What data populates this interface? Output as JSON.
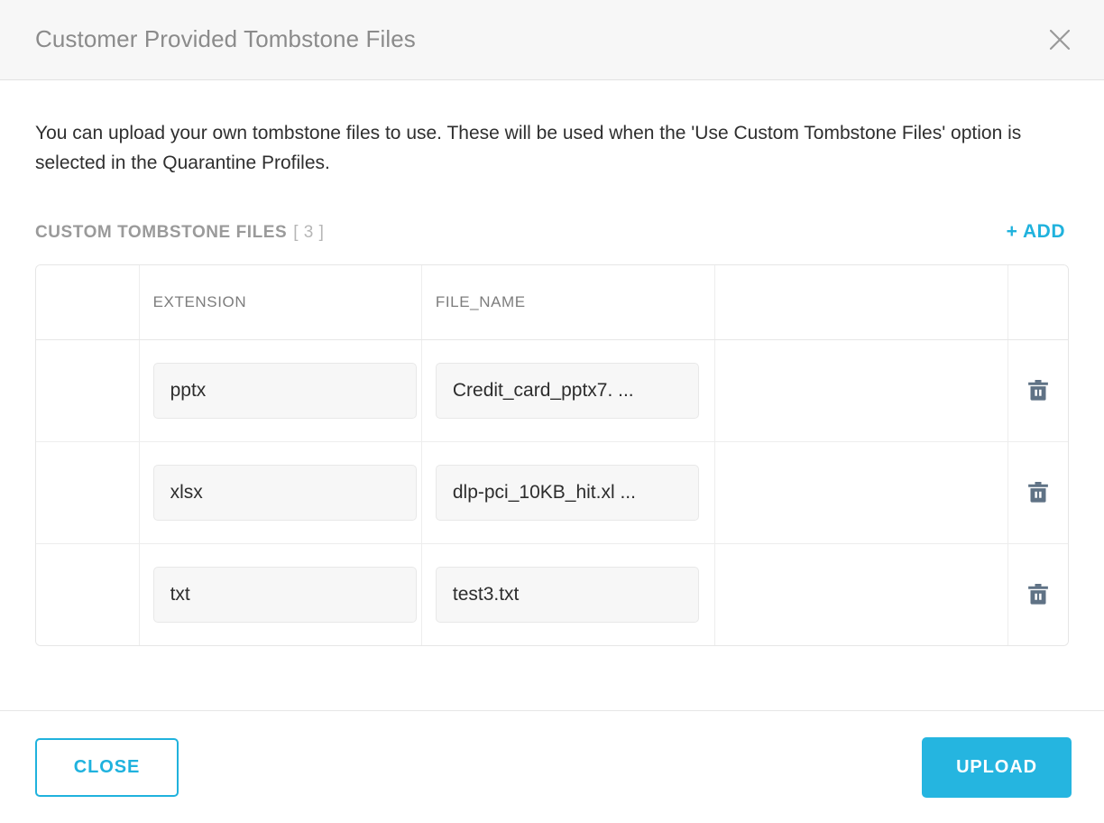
{
  "dialog": {
    "title": "Customer Provided Tombstone Files",
    "close_icon": "close-icon",
    "description": "You can upload your own tombstone files to use. These will be used when the 'Use Custom Tombstone Files' option is selected in the Quarantine Profiles."
  },
  "section": {
    "title": "CUSTOM TOMBSTONE FILES",
    "count": "[ 3 ]",
    "add_label": "+ ADD"
  },
  "table": {
    "columns": [
      "",
      "EXTENSION",
      "FILE_NAME",
      "",
      ""
    ],
    "rows": [
      {
        "extension": "pptx",
        "file_name": "Credit_card_pptx7. ...",
        "delete_icon": "trash-icon"
      },
      {
        "extension": "xlsx",
        "file_name": "dlp-pci_10KB_hit.xl ...",
        "delete_icon": "trash-icon"
      },
      {
        "extension": "txt",
        "file_name": "test3.txt",
        "delete_icon": "trash-icon"
      }
    ]
  },
  "footer": {
    "close_label": "CLOSE",
    "upload_label": "UPLOAD"
  },
  "colors": {
    "accent": "#25b5e0",
    "accent_outline": "#20b2dd",
    "title_text": "#8b8b8b",
    "body_text": "#2f2f2f",
    "section_label": "#9a9a9a",
    "trash_icon": "#5f7285",
    "header_bg": "#f7f7f7",
    "input_bg": "#f7f7f7",
    "border": "#e6e6e6"
  }
}
